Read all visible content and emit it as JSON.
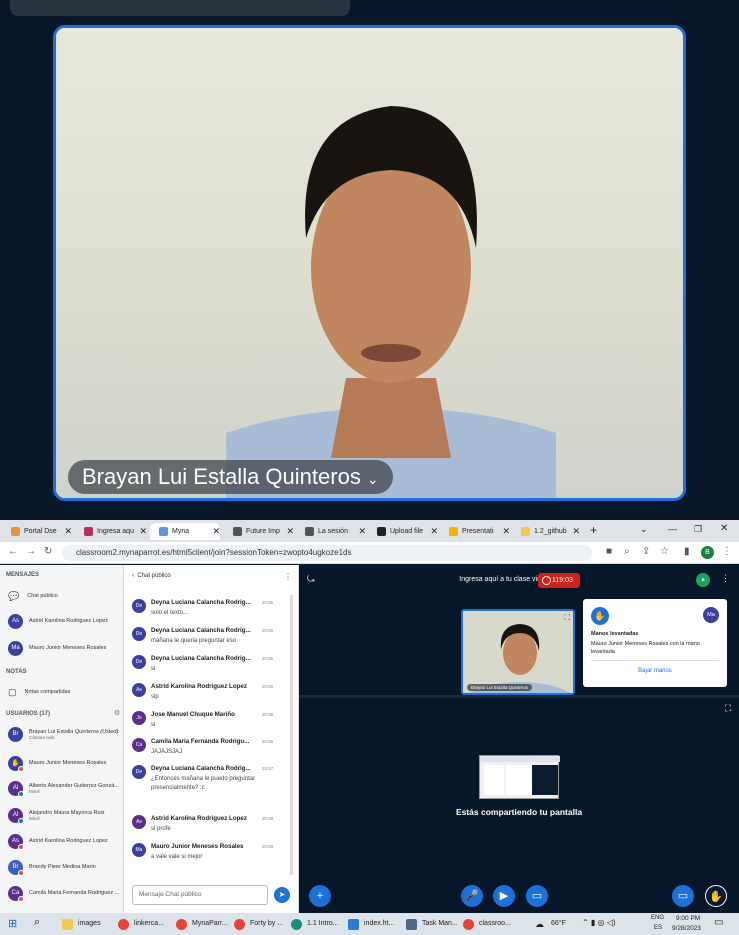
{
  "video": {
    "name": "Brayan Lui Estalla Quinteros"
  },
  "browser": {
    "tabs": [
      "Portal Dse",
      "Ingresa aqu",
      "Myna",
      "Future Imp",
      "La sesión",
      "Upload file",
      "Presentati",
      "1.2_github"
    ],
    "url": "classroom2.mynaparrot.es/html5client/join?sessionToken=zwopto4ugkoze1ds",
    "profile": "B"
  },
  "sidebar": {
    "mensajes_label": "MENSAJES",
    "chat_publico": "Chat público",
    "dm": [
      {
        "initials": "As",
        "name": "Astrid Karolina Rodriguez Lopez"
      },
      {
        "initials": "Ma",
        "name": "Mauro Junior Meneses Rosales"
      }
    ],
    "notas_label": "NOTAS",
    "notas_compartidas": "Notas compartidas",
    "usuarios_label": "USUARIOS (17)",
    "users": [
      {
        "initials": "Br",
        "name": "Brayan Lui Estalla Quinteros",
        "tag": "(Usted)",
        "sub": "Cámara web"
      },
      {
        "initials": "",
        "name": "Mauro Junior Meneses Rosales",
        "tag": "",
        "sub": ""
      },
      {
        "initials": "Al",
        "name": "Alberto Alexander Gutierrez Gonzá...",
        "tag": "",
        "sub": "Móvil"
      },
      {
        "initials": "Al",
        "name": "Alejandro Maura Mayorca Ruiz",
        "tag": "",
        "sub": "Móvil"
      },
      {
        "initials": "As",
        "name": "Astrid Karolina Rodriguez Lopez",
        "tag": "",
        "sub": ""
      },
      {
        "initials": "Br",
        "name": "Brandy Pieer Medina Marin",
        "tag": "",
        "sub": ""
      },
      {
        "initials": "Ca",
        "name": "Camila Maria Fernanda Rodriguez ...",
        "tag": "",
        "sub": ""
      }
    ]
  },
  "chat": {
    "header": "Chat público",
    "messages": [
      {
        "initials": "De",
        "name": "Deyna Luciana Calancha Rodrig...",
        "time": "20:55",
        "text": "solo el texto..."
      },
      {
        "initials": "De",
        "name": "Deyna Luciana Calancha Rodrig...",
        "time": "20:55",
        "text": "mañana le queria preguntar eso"
      },
      {
        "initials": "De",
        "name": "Deyna Luciana Calancha Rodrig...",
        "time": "20:55",
        "text": "si"
      },
      {
        "initials": "As",
        "name": "Astrid Karolina Rodriguez Lopez",
        "time": "20:55",
        "text": "sip"
      },
      {
        "initials": "Jo",
        "name": "Jose Manuel Chuque Mariño",
        "time": "20:56",
        "text": "si"
      },
      {
        "initials": "Ca",
        "name": "Camila Maria Fernanda Rodrigu...",
        "time": "20:56",
        "text": "JAJAJSJAJ"
      },
      {
        "initials": "De",
        "name": "Deyna Luciana Calancha Rodrig...",
        "time": "20:57",
        "text": "¿Entonces mañana le puedo preguntar presencialmente? :c"
      },
      {
        "initials": "As",
        "name": "Astrid Karolina Rodriguez Lopez",
        "time": "20:59",
        "text": "si profe"
      },
      {
        "initials": "Ma",
        "name": "Mauro Junior Meneses Rosales",
        "time": "20:59",
        "text": "a vale vale  si mejor"
      }
    ],
    "input_placeholder": "Mensaje Chat público"
  },
  "stage": {
    "title": "Ingresa aquí a tu clase virtual",
    "recording_time": "119:03",
    "cam_name": "Brayan Lui Estalla Quinteros",
    "raised_hands": {
      "avatar": "Ma",
      "title": "Manos levantadas",
      "text": "Mauro Junior Meneses Rosales con la mano levantada",
      "button": "Bajar manos"
    },
    "share_text": "Estás compartiendo tu pantalla"
  },
  "taskbar": {
    "items": [
      "images",
      "linkerca...",
      "MynaParr...",
      "Forty by ...",
      "1.1 Intro...",
      "index.ht...",
      "Task Man...",
      "classroo..."
    ],
    "weather": "66°F",
    "lang": "ENG",
    "lang2": "ES",
    "time": "9:00 PM",
    "date": "9/28/2023"
  }
}
